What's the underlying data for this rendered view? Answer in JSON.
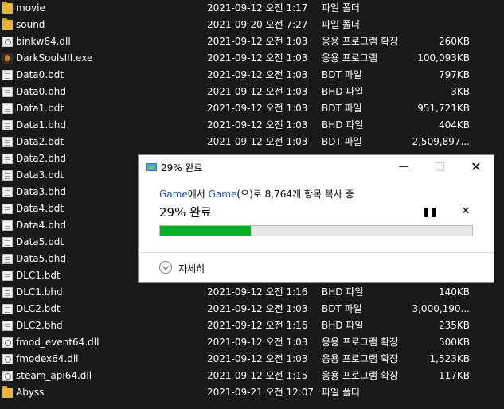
{
  "files": [
    {
      "name": "movie",
      "date": "2021-09-12 오전 1:17",
      "type": "파일 폴더",
      "size": "",
      "icon": "folder-icon"
    },
    {
      "name": "sound",
      "date": "2021-09-20 오전 7:27",
      "type": "파일 폴더",
      "size": "",
      "icon": "folder-icon"
    },
    {
      "name": "binkw64.dll",
      "date": "2021-09-12 오전 1:03",
      "type": "응용 프로그램 확장",
      "size": "260KB",
      "icon": "dll-icon"
    },
    {
      "name": "DarkSoulsIII.exe",
      "date": "2021-09-12 오전 1:03",
      "type": "응용 프로그램",
      "size": "100,093KB",
      "icon": "exe-icon"
    },
    {
      "name": "Data0.bdt",
      "date": "2021-09-12 오전 1:03",
      "type": "BDT 파일",
      "size": "797KB",
      "icon": "file-icon"
    },
    {
      "name": "Data0.bhd",
      "date": "2021-09-12 오전 1:03",
      "type": "BHD 파일",
      "size": "3KB",
      "icon": "file-icon"
    },
    {
      "name": "Data1.bdt",
      "date": "2021-09-12 오전 1:03",
      "type": "BDT 파일",
      "size": "951,721KB",
      "icon": "file-icon"
    },
    {
      "name": "Data1.bhd",
      "date": "2021-09-12 오전 1:03",
      "type": "BHD 파일",
      "size": "404KB",
      "icon": "file-icon"
    },
    {
      "name": "Data2.bdt",
      "date": "2021-09-12 오전 1:03",
      "type": "BDT 파일",
      "size": "2,509,897...",
      "icon": "file-icon"
    },
    {
      "name": "Data2.bhd",
      "date": "",
      "type": "",
      "size": "",
      "icon": "file-icon"
    },
    {
      "name": "Data3.bdt",
      "date": "",
      "type": "",
      "size": "",
      "icon": "file-icon"
    },
    {
      "name": "Data3.bhd",
      "date": "",
      "type": "",
      "size": "",
      "icon": "file-icon"
    },
    {
      "name": "Data4.bdt",
      "date": "",
      "type": "",
      "size": "",
      "icon": "file-icon"
    },
    {
      "name": "Data4.bhd",
      "date": "",
      "type": "",
      "size": "",
      "icon": "file-icon"
    },
    {
      "name": "Data5.bdt",
      "date": "",
      "type": "",
      "size": "",
      "icon": "file-icon"
    },
    {
      "name": "Data5.bhd",
      "date": "",
      "type": "",
      "size": "",
      "icon": "file-icon"
    },
    {
      "name": "DLC1.bdt",
      "date": "",
      "type": "",
      "size": "",
      "icon": "file-icon"
    },
    {
      "name": "DLC1.bhd",
      "date": "2021-09-12 오전 1:16",
      "type": "BHD 파일",
      "size": "140KB",
      "icon": "file-icon"
    },
    {
      "name": "DLC2.bdt",
      "date": "2021-09-12 오전 1:03",
      "type": "BDT 파일",
      "size": "3,000,190...",
      "icon": "file-icon"
    },
    {
      "name": "DLC2.bhd",
      "date": "2021-09-12 오전 1:16",
      "type": "BHD 파일",
      "size": "235KB",
      "icon": "file-icon"
    },
    {
      "name": "fmod_event64.dll",
      "date": "2021-09-12 오전 1:03",
      "type": "응용 프로그램 확장",
      "size": "500KB",
      "icon": "dll-icon"
    },
    {
      "name": "fmodex64.dll",
      "date": "2021-09-12 오전 1:03",
      "type": "응용 프로그램 확장",
      "size": "1,523KB",
      "icon": "dll-icon"
    },
    {
      "name": "steam_api64.dll",
      "date": "2021-09-12 오전 1:15",
      "type": "응용 프로그램 확장",
      "size": "117KB",
      "icon": "dll-icon"
    },
    {
      "name": "Abyss",
      "date": "2021-09-21 오전 12:07",
      "type": "파일 폴더",
      "size": "",
      "icon": "folder-icon"
    }
  ],
  "dialog": {
    "title": "29% 완료",
    "source": "Game",
    "from_text": "에서 ",
    "dest": "Game",
    "dest_suffix": "(으)로 8,764개 항목 복사 중",
    "percent_label": "29% 완료",
    "progress": 0.29,
    "progress_color": "#06b025",
    "pause_symbol": "❚❚",
    "cancel_symbol": "✕",
    "details_label": "자세히",
    "min_symbol": "—",
    "close_symbol": "✕"
  }
}
